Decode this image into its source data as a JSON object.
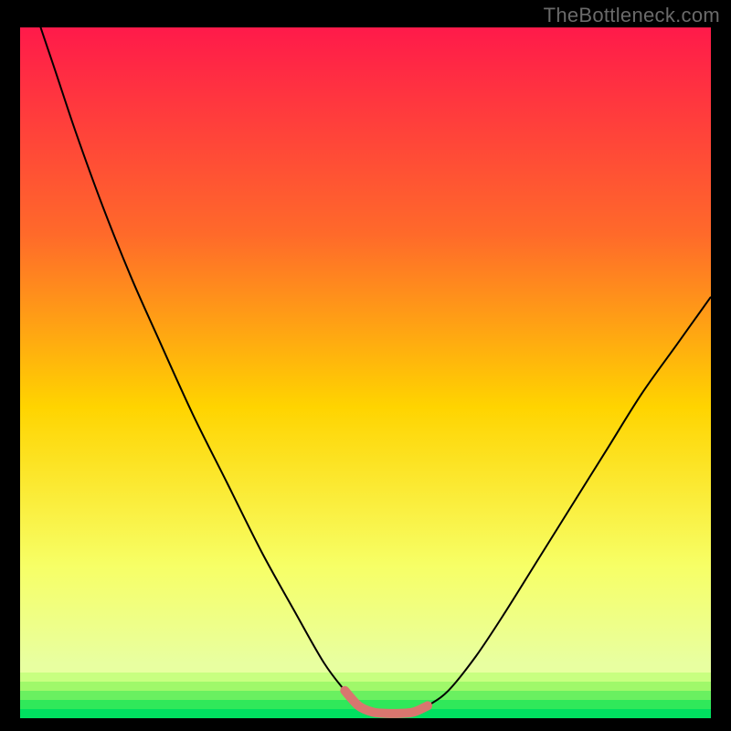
{
  "watermark": "TheBottleneck.com",
  "colors": {
    "bg": "#000000",
    "grad_top": "#ff1a4a",
    "grad_q1": "#ff6a2a",
    "grad_mid": "#ffd400",
    "grad_q3": "#f7ff66",
    "grad_band": "#e8ffa0",
    "grad_bottom": "#00e060",
    "curve": "#000000",
    "highlight": "#d9766f"
  },
  "chart_data": {
    "type": "line",
    "title": "",
    "xlabel": "",
    "ylabel": "",
    "xlim": [
      0,
      100
    ],
    "ylim": [
      0,
      100
    ],
    "x": [
      0,
      2,
      5,
      8,
      12,
      16,
      20,
      25,
      30,
      35,
      40,
      44,
      47,
      49,
      51,
      53,
      55,
      57,
      59,
      62,
      66,
      70,
      75,
      80,
      85,
      90,
      95,
      100
    ],
    "values": [
      110,
      103,
      94,
      85,
      74,
      64,
      55,
      44,
      34,
      24,
      15,
      8,
      4,
      1.8,
      0.9,
      0.7,
      0.7,
      0.9,
      1.8,
      4,
      9,
      15,
      23,
      31,
      39,
      47,
      54,
      61
    ],
    "highlight_range_x": [
      47,
      59
    ],
    "series": [
      {
        "name": "bottleneck-curve",
        "x": [
          0,
          2,
          5,
          8,
          12,
          16,
          20,
          25,
          30,
          35,
          40,
          44,
          47,
          49,
          51,
          53,
          55,
          57,
          59,
          62,
          66,
          70,
          75,
          80,
          85,
          90,
          95,
          100
        ],
        "values": [
          110,
          103,
          94,
          85,
          74,
          64,
          55,
          44,
          34,
          24,
          15,
          8,
          4,
          1.8,
          0.9,
          0.7,
          0.7,
          0.9,
          1.8,
          4,
          9,
          15,
          23,
          31,
          39,
          47,
          54,
          61
        ]
      }
    ]
  }
}
